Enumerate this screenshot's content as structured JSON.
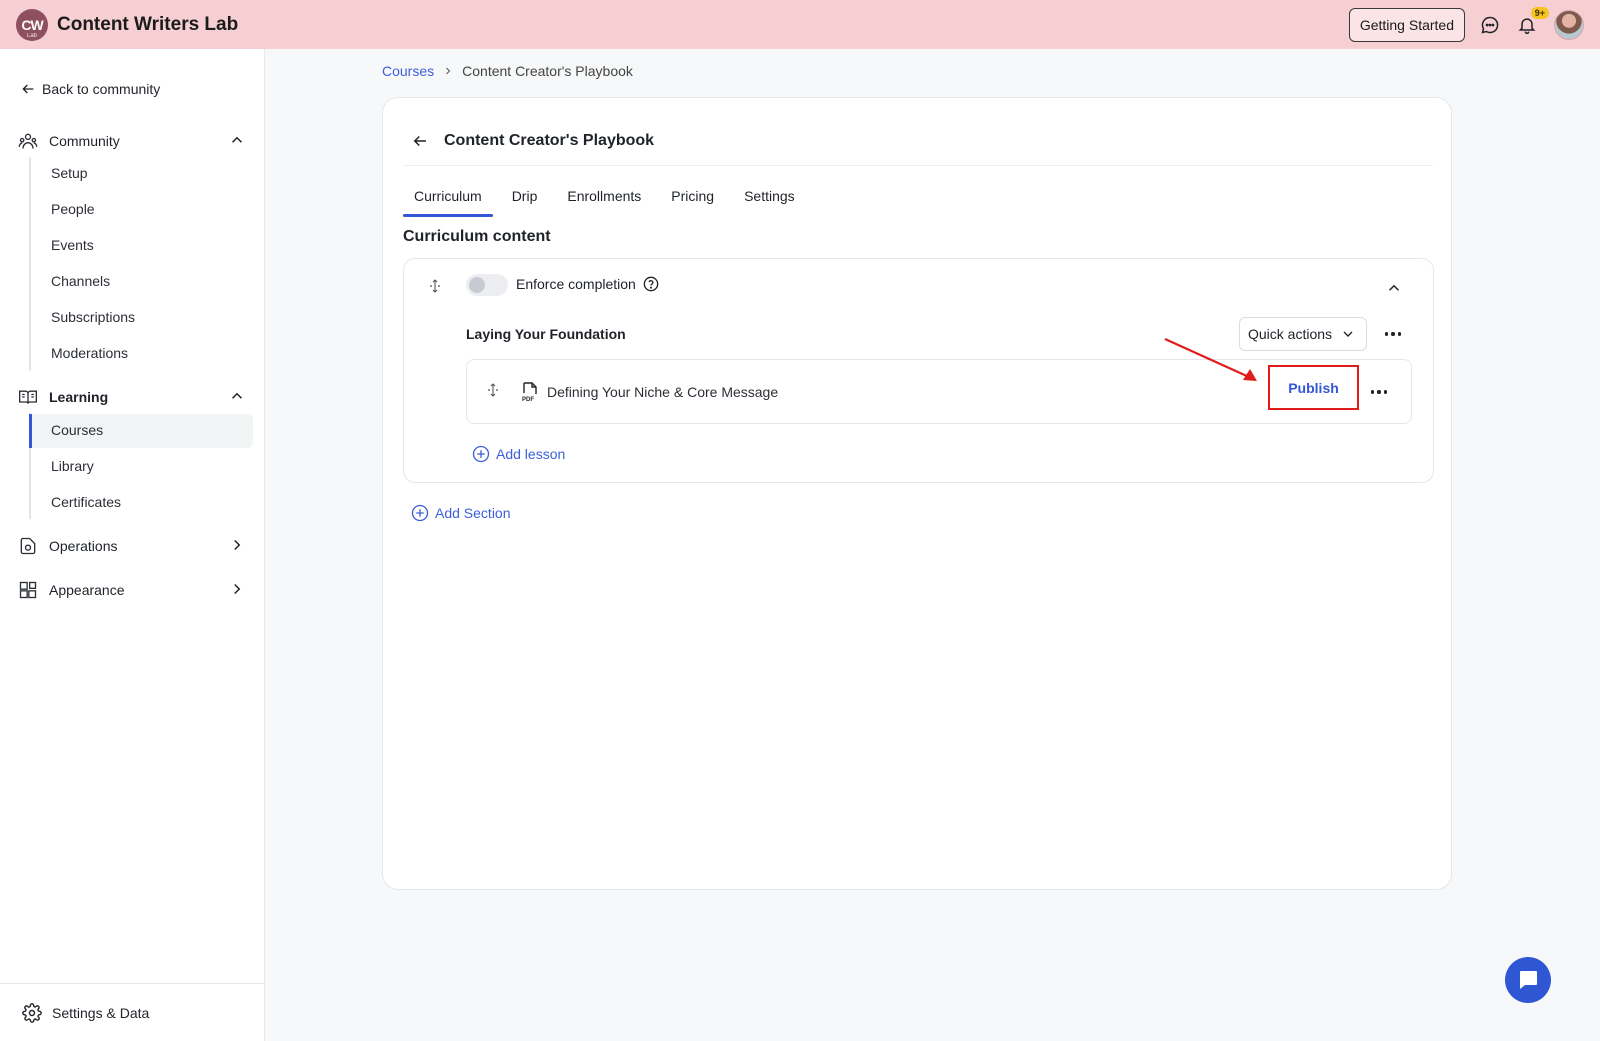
{
  "header": {
    "logo_text": "CW",
    "logo_sub": "Lab",
    "brand": "Content Writers Lab",
    "getting_started": "Getting Started",
    "notification_badge": "9+"
  },
  "sidebar": {
    "back_link": "Back to community",
    "community": {
      "label": "Community",
      "items": [
        "Setup",
        "People",
        "Events",
        "Channels",
        "Subscriptions",
        "Moderations"
      ]
    },
    "learning": {
      "label": "Learning",
      "items": [
        "Courses",
        "Library",
        "Certificates"
      ],
      "active": "Courses"
    },
    "operations": "Operations",
    "appearance": "Appearance",
    "footer": "Settings & Data"
  },
  "breadcrumb": {
    "root": "Courses",
    "current": "Content Creator's Playbook"
  },
  "course": {
    "title": "Content Creator's Playbook",
    "tabs": [
      "Curriculum",
      "Drip",
      "Enrollments",
      "Pricing",
      "Settings"
    ],
    "active_tab": "Curriculum",
    "section_heading": "Curriculum content",
    "enforce_label": "Enforce completion",
    "enforce_on": false,
    "section": {
      "name": "Laying Your Foundation",
      "quick_actions": "Quick actions",
      "lessons": [
        {
          "title": "Defining Your Niche & Core Message",
          "action": "Publish"
        }
      ],
      "add_lesson": "Add lesson"
    },
    "add_section": "Add Section"
  },
  "colors": {
    "accent": "#3357d6",
    "topbar": "#f6cfd2",
    "highlight": "#e01b1b"
  }
}
